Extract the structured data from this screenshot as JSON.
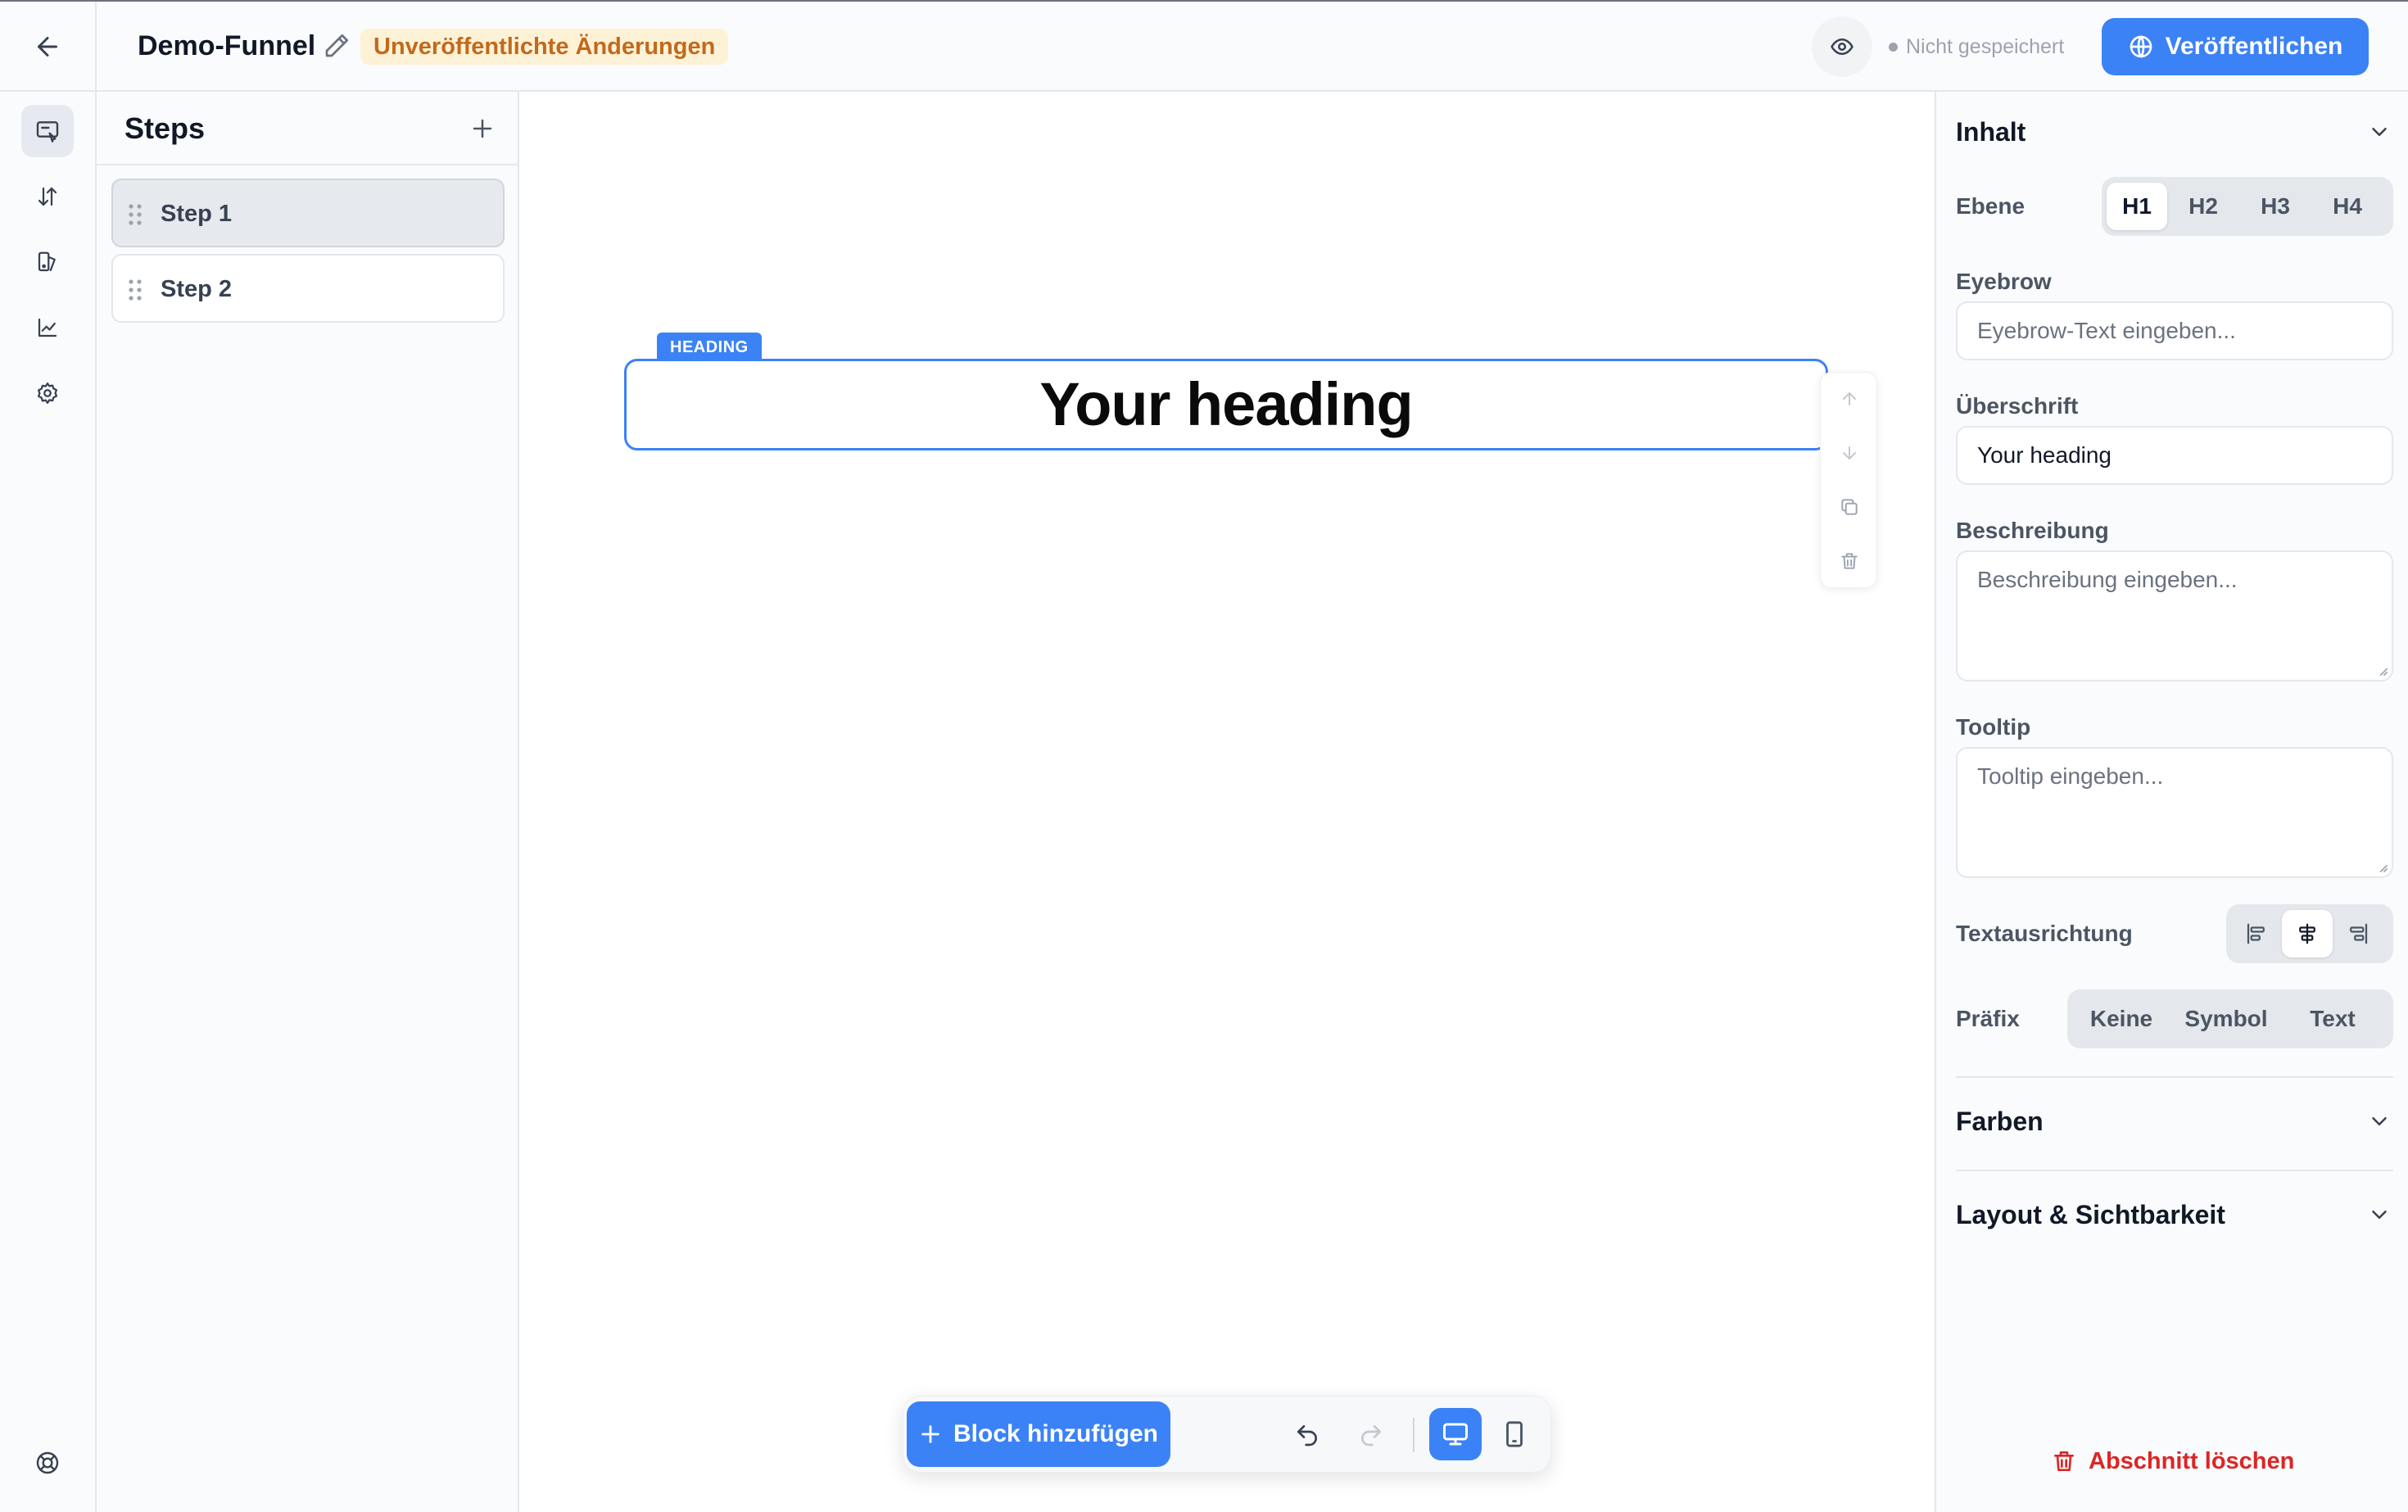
{
  "header": {
    "funnel_title": "Demo-Funnel",
    "unsaved_badge": "Unveröffentlichte Änderungen",
    "save_status": "Nicht gespeichert",
    "publish_label": "Veröffentlichen"
  },
  "rail": {
    "items": [
      "editor-icon",
      "sort-icon",
      "layers-icon",
      "chart-icon",
      "gear-icon"
    ],
    "bottom_icon": "lifebuoy-icon"
  },
  "steps": {
    "title": "Steps",
    "items": [
      {
        "label": "Step 1",
        "active": true
      },
      {
        "label": "Step 2",
        "active": false
      }
    ]
  },
  "canvas": {
    "block_tag": "HEADING",
    "heading_text": "Your heading"
  },
  "toolbar": {
    "add_block_label": "Block hinzufügen"
  },
  "props": {
    "content_section": "Inhalt",
    "level_label": "Ebene",
    "levels": [
      "H1",
      "H2",
      "H3",
      "H4"
    ],
    "level_selected": "H1",
    "eyebrow_label": "Eyebrow",
    "eyebrow_placeholder": "Eyebrow-Text eingeben...",
    "heading_label": "Überschrift",
    "heading_value": "Your heading",
    "description_label": "Beschreibung",
    "description_placeholder": "Beschreibung eingeben...",
    "tooltip_label": "Tooltip",
    "tooltip_placeholder": "Tooltip eingeben...",
    "align_label": "Textausrichtung",
    "align_selected": "center",
    "prefix_label": "Präfix",
    "prefix_options": [
      "Keine",
      "Symbol",
      "Text"
    ],
    "colors_section": "Farben",
    "layout_section": "Layout & Sichtbarkeit",
    "delete_label": "Abschnitt löschen"
  },
  "colors": {
    "accent": "#3b82f6",
    "warning_bg": "#fdf2d6",
    "warning_text": "#c2691c",
    "danger": "#dc2626"
  }
}
